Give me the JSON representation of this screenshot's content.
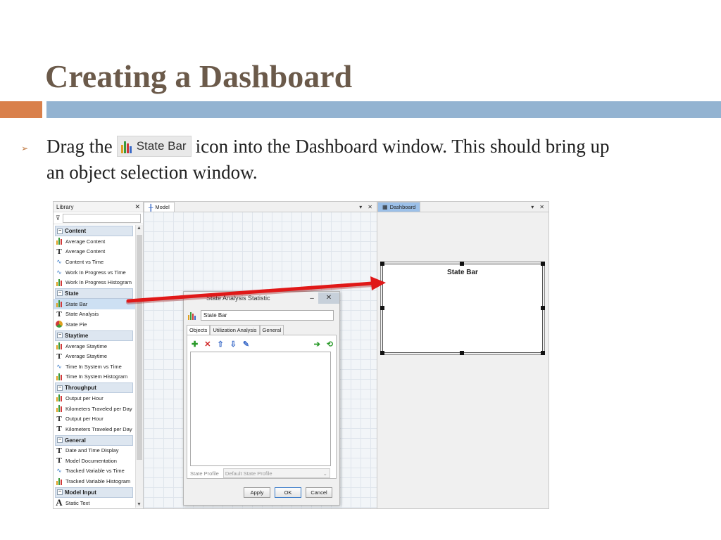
{
  "slide": {
    "title": "Creating a Dashboard",
    "bullet_prefix": "Drag the",
    "bullet_icon_label": "State Bar",
    "bullet_suffix": "icon into the Dashboard window. This should bring up",
    "bullet_line2": "an object selection window."
  },
  "library": {
    "title": "Library",
    "categories": [
      {
        "label": "Content",
        "items": [
          {
            "label": "Average Content",
            "icon": "bar-chart-icon"
          },
          {
            "label": "Average Content",
            "icon": "text-icon"
          },
          {
            "label": "Content vs Time",
            "icon": "line-chart-icon"
          },
          {
            "label": "Work In Progress vs Time",
            "icon": "line-chart-icon"
          },
          {
            "label": "Work In Progress Histogram",
            "icon": "bar-chart-icon"
          }
        ]
      },
      {
        "label": "State",
        "items": [
          {
            "label": "State Bar",
            "icon": "bar-chart-icon"
          },
          {
            "label": "State Analysis",
            "icon": "text-icon"
          },
          {
            "label": "State Pie",
            "icon": "pie-chart-icon"
          }
        ]
      },
      {
        "label": "Staytime",
        "items": [
          {
            "label": "Average Staytime",
            "icon": "bar-chart-icon"
          },
          {
            "label": "Average Staytime",
            "icon": "text-icon"
          },
          {
            "label": "Time In System vs Time",
            "icon": "line-chart-icon"
          },
          {
            "label": "Time In System Histogram",
            "icon": "bar-chart-icon"
          }
        ]
      },
      {
        "label": "Throughput",
        "items": [
          {
            "label": "Output per Hour",
            "icon": "bar-chart-icon"
          },
          {
            "label": "Kilometers Traveled per Day",
            "icon": "bar-chart-icon"
          },
          {
            "label": "Output per Hour",
            "icon": "text-icon"
          },
          {
            "label": "Kilometers Traveled per Day",
            "icon": "text-icon"
          }
        ]
      },
      {
        "label": "General",
        "items": [
          {
            "label": "Date and Time Display",
            "icon": "text-icon"
          },
          {
            "label": "Model Documentation",
            "icon": "text-icon"
          },
          {
            "label": "Tracked Variable vs Time",
            "icon": "line-chart-icon"
          },
          {
            "label": "Tracked Variable Histogram",
            "icon": "bar-chart-icon"
          }
        ]
      },
      {
        "label": "Model Input",
        "items": [
          {
            "label": "Static Text",
            "icon": "static-text-icon"
          }
        ]
      }
    ]
  },
  "model": {
    "tab_label": "Model"
  },
  "dashboard": {
    "tab_label": "Dashboard",
    "widget_title": "State Bar"
  },
  "dialog": {
    "title": "State Analysis Statistic",
    "name_value": "State Bar",
    "tabs": [
      "Objects",
      "Utilization Analysis",
      "General"
    ],
    "state_profile_label": "State Profile",
    "state_profile_value": "Default State Profile",
    "apply": "Apply",
    "ok": "OK",
    "cancel": "Cancel"
  },
  "colors": {
    "title": "#6b5a4a",
    "accent_orange": "#d9804b",
    "accent_blue": "#93b3d1",
    "arrow_red": "#e01818"
  }
}
